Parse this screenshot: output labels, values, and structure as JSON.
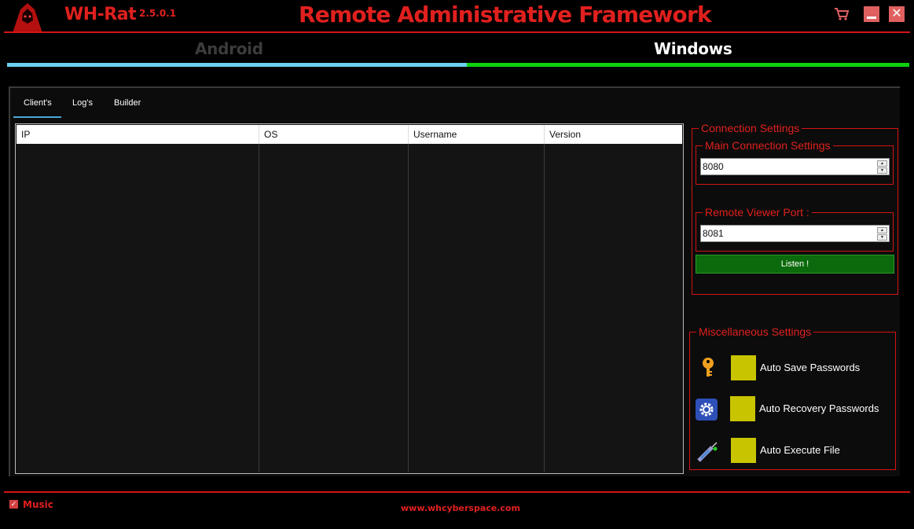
{
  "titlebar": {
    "app_name": "WH-Rat",
    "version": "2.5.0.1",
    "title": "Remote Administrative Framework",
    "close_glyph": "✕"
  },
  "platform_tabs": [
    {
      "label": "Android",
      "active": false
    },
    {
      "label": "Windows",
      "active": true
    }
  ],
  "inner_tabs": [
    {
      "label": "Client's",
      "active": true
    },
    {
      "label": "Log's",
      "active": false
    },
    {
      "label": "Builder",
      "active": false
    }
  ],
  "table": {
    "columns": [
      "IP",
      "OS",
      "Username",
      "Version"
    ],
    "rows": []
  },
  "connection_settings": {
    "legend": "Connection Settings",
    "main": {
      "legend": "Main Connection Settings",
      "value": "8080"
    },
    "viewer": {
      "legend": "Remote Viewer Port :",
      "value": "8081"
    },
    "listen_label": "Listen !"
  },
  "misc_settings": {
    "legend": "Miscellaneous Settings",
    "items": [
      {
        "label": "Auto Save Passwords",
        "icon": "key-icon"
      },
      {
        "label": "Auto Recovery Passwords",
        "icon": "gear-icon"
      },
      {
        "label": "Auto Execute File",
        "icon": "syringe-icon"
      }
    ]
  },
  "footer": {
    "music_label": "Music",
    "music_checked": true,
    "website": "www.whcyberspace.com"
  },
  "colors": {
    "accent_red": "#e0201e",
    "android_bar": "#6cd0ee",
    "windows_bar": "#0ed10e",
    "checkbox": "#c8c400",
    "listen_green": "#0b6a0b"
  }
}
